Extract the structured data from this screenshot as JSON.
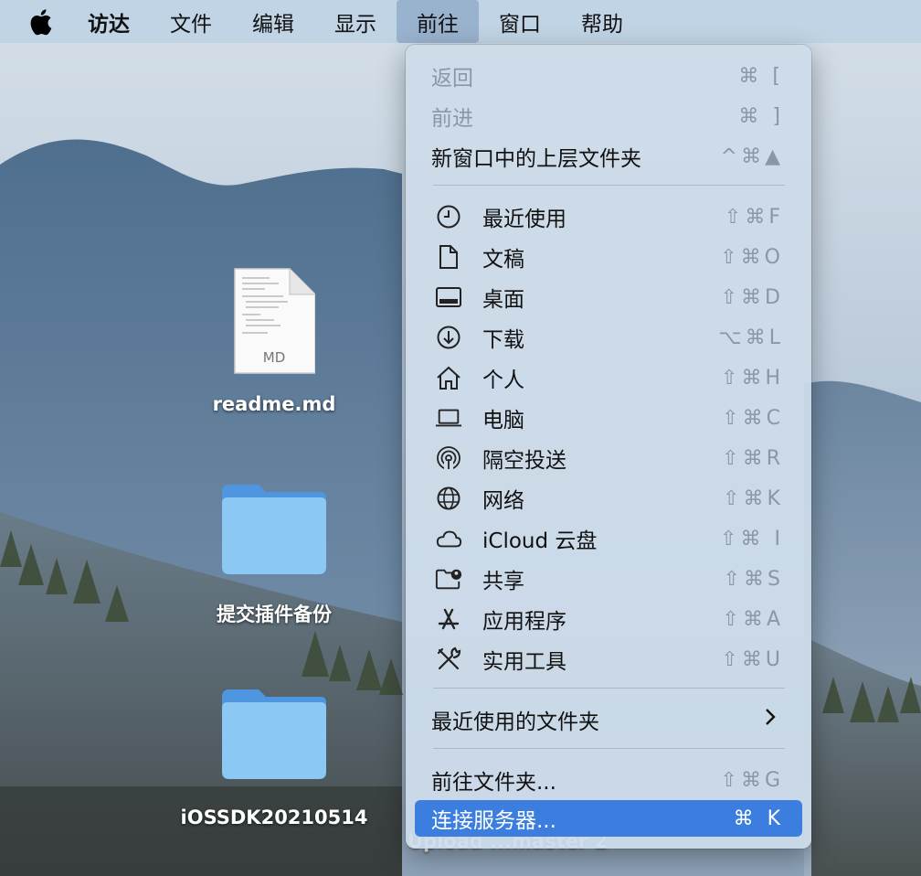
{
  "menubar": {
    "apple_icon": "apple-logo",
    "items": [
      {
        "label": "访达",
        "bold": true
      },
      {
        "label": "文件"
      },
      {
        "label": "编辑"
      },
      {
        "label": "显示"
      },
      {
        "label": "前往",
        "active": true
      },
      {
        "label": "窗口"
      },
      {
        "label": "帮助"
      }
    ]
  },
  "desktop": {
    "readme": {
      "label": "readme.md",
      "type_tag": "MD"
    },
    "folder1": {
      "label": "提交插件备份"
    },
    "folder2": {
      "label": "iOSSDK20210514"
    },
    "hidden_label": "Upload ...master 2"
  },
  "menu": {
    "back": {
      "label": "返回",
      "shortcut": "⌘ ["
    },
    "forward": {
      "label": "前进",
      "shortcut": "⌘ ]"
    },
    "enclosing": {
      "label": "新窗口中的上层文件夹",
      "shortcut": "^⌘▲"
    },
    "places": [
      {
        "label": "最近使用",
        "shortcut": "⇧⌘F",
        "icon": "clock-icon"
      },
      {
        "label": "文稿",
        "shortcut": "⇧⌘O",
        "icon": "document-icon"
      },
      {
        "label": "桌面",
        "shortcut": "⇧⌘D",
        "icon": "desktop-icon"
      },
      {
        "label": "下载",
        "shortcut": "⌥⌘L",
        "icon": "download-icon"
      },
      {
        "label": "个人",
        "shortcut": "⇧⌘H",
        "icon": "home-icon"
      },
      {
        "label": "电脑",
        "shortcut": "⇧⌘C",
        "icon": "laptop-icon"
      },
      {
        "label": "隔空投送",
        "shortcut": "⇧⌘R",
        "icon": "airdrop-icon"
      },
      {
        "label": "网络",
        "shortcut": "⇧⌘K",
        "icon": "globe-icon"
      },
      {
        "label": "iCloud 云盘",
        "shortcut": "⇧⌘ I",
        "icon": "cloud-icon"
      },
      {
        "label": "共享",
        "shortcut": "⇧⌘S",
        "icon": "shared-folder-icon"
      },
      {
        "label": "应用程序",
        "shortcut": "⇧⌘A",
        "icon": "applications-icon"
      },
      {
        "label": "实用工具",
        "shortcut": "⇧⌘U",
        "icon": "utilities-icon"
      }
    ],
    "recent_folders": {
      "label": "最近使用的文件夹",
      "chevron": "›"
    },
    "goto_folder": {
      "label": "前往文件夹...",
      "shortcut": "⇧⌘G"
    },
    "connect_server": {
      "label": "连接服务器...",
      "shortcut": "⌘ K"
    }
  }
}
